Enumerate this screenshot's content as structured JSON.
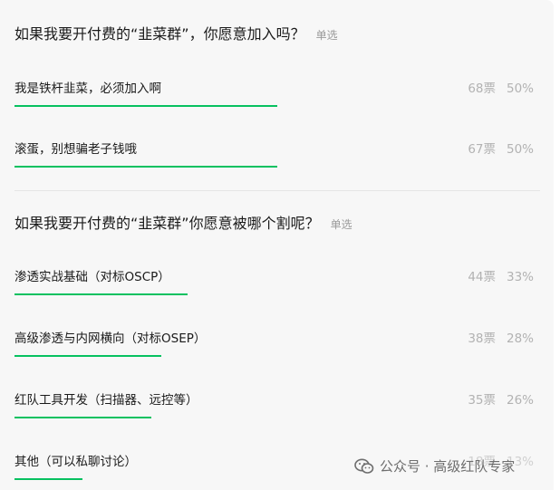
{
  "polls": [
    {
      "question": "如果我要开付费的“韭菜群”，你愿意加入吗？",
      "type": "单选",
      "options": [
        {
          "label": "我是铁杆韭菜，必须加入啊",
          "votes": "68票",
          "percent": "50%",
          "ratio": 0.5
        },
        {
          "label": "滚蛋，别想骗老子钱哦",
          "votes": "67票",
          "percent": "50%",
          "ratio": 0.5
        }
      ]
    },
    {
      "question": "如果我要开付费的“韭菜群”你愿意被哪个割呢？",
      "type": "单选",
      "options": [
        {
          "label": "渗透实战基础（对标OSCP）",
          "votes": "44票",
          "percent": "33%",
          "ratio": 0.33
        },
        {
          "label": "高级渗透与内网横向（对标OSEP）",
          "votes": "38票",
          "percent": "28%",
          "ratio": 0.28
        },
        {
          "label": "红队工具开发（扫描器、远控等）",
          "votes": "35票",
          "percent": "26%",
          "ratio": 0.26
        },
        {
          "label": "其他（可以私聊讨论）",
          "votes": "18票",
          "percent": "13%",
          "ratio": 0.13
        }
      ]
    }
  ],
  "watermark": {
    "text": "公众号 · 高级红队专家",
    "icon": "wechat-icon"
  },
  "colors": {
    "bar": "#07c160",
    "background": "#f7f7f7"
  }
}
